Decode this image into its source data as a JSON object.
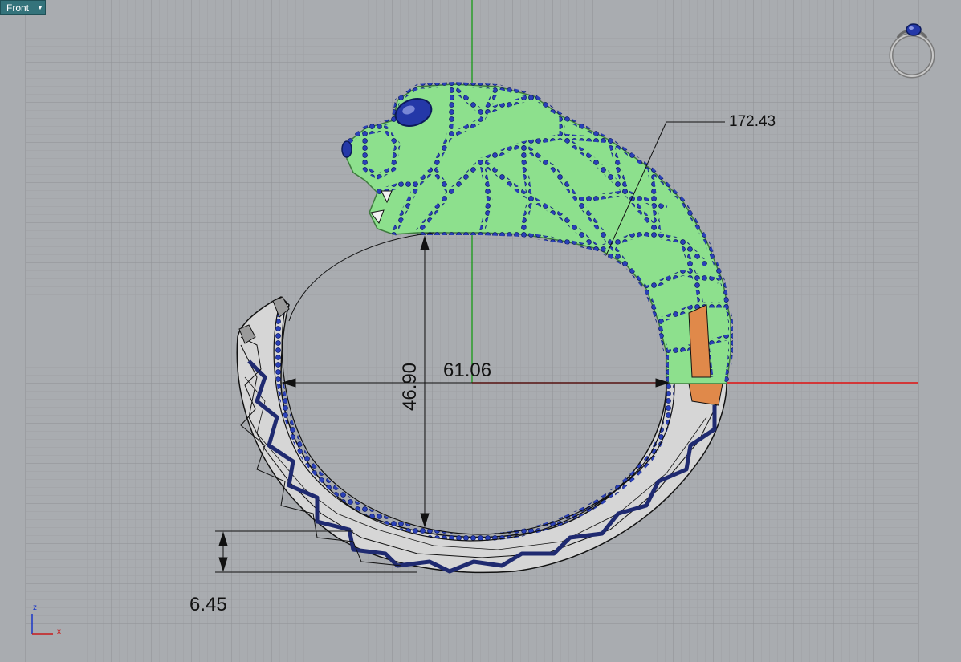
{
  "viewport": {
    "name": "Front",
    "dropdown_icon": "triangle-down-icon"
  },
  "dimensions": {
    "radius_label": "172.43",
    "width_label": "61.06",
    "height_label": "46.90",
    "thickness_label": "6.45"
  },
  "axis_gizmo": {
    "z_label": "z",
    "x_label": "x",
    "z_color": "#1a36c8",
    "x_color": "#c81a1a"
  },
  "colors": {
    "background": "#a9acb0",
    "grid_minor": "#9da0a4",
    "grid_major": "#8b8e92",
    "x_axis": "#e01010",
    "y_axis": "#0b9a0b",
    "selection_green": "#8de08d",
    "gem_blue": "#2438a8",
    "metal_gray": "#c8c8c8",
    "accent_orange": "#e0894a"
  },
  "view_cube_icon": "ring-preview-icon"
}
